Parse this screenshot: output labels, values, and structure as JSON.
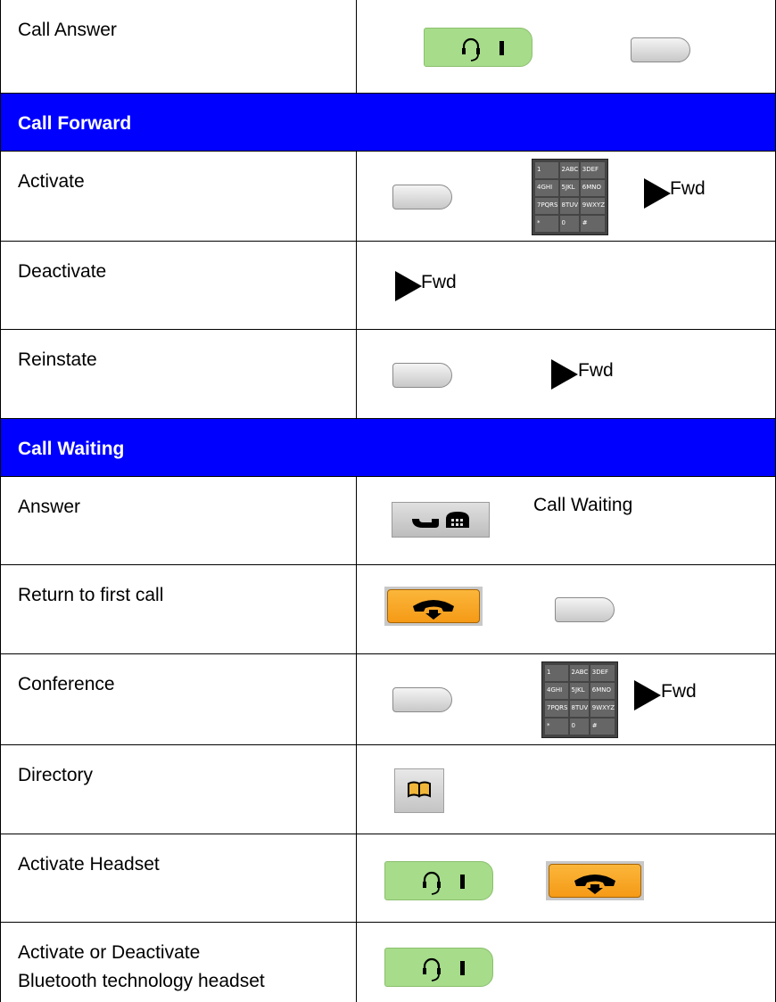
{
  "rows": [
    {
      "label": "Call Answer"
    },
    {
      "section": "Call Forward"
    },
    {
      "label": "Activate",
      "fwd": "Fwd"
    },
    {
      "label": "Deactivate",
      "fwd": "Fwd"
    },
    {
      "label": "Reinstate",
      "fwd": "Fwd"
    },
    {
      "section": "Call Waiting"
    },
    {
      "label": "Answer",
      "text": "Call Waiting"
    },
    {
      "label": "Return to first call"
    },
    {
      "label": "Conference",
      "fwd": "Fwd"
    },
    {
      "label": "Directory"
    },
    {
      "label": "Activate Headset"
    },
    {
      "label": "Activate or Deactivate",
      "label2": "Bluetooth technology headset"
    }
  ],
  "keypad_keys": [
    "1",
    "2ABC",
    "3DEF",
    "4GHI",
    "5JKL",
    "6MNO",
    "7PQRS",
    "8TUV",
    "9WXYZ",
    "*",
    "0",
    "#"
  ],
  "colors": {
    "section_bg": "#0000ff",
    "headset_key": "#a6dc8a",
    "release_key": "#f59a17"
  },
  "icons": [
    "headset-key-icon",
    "softkey-icon",
    "keypad-icon",
    "arrow-right-icon",
    "call-waiting-key-icon",
    "release-key-icon",
    "directory-key-icon"
  ]
}
